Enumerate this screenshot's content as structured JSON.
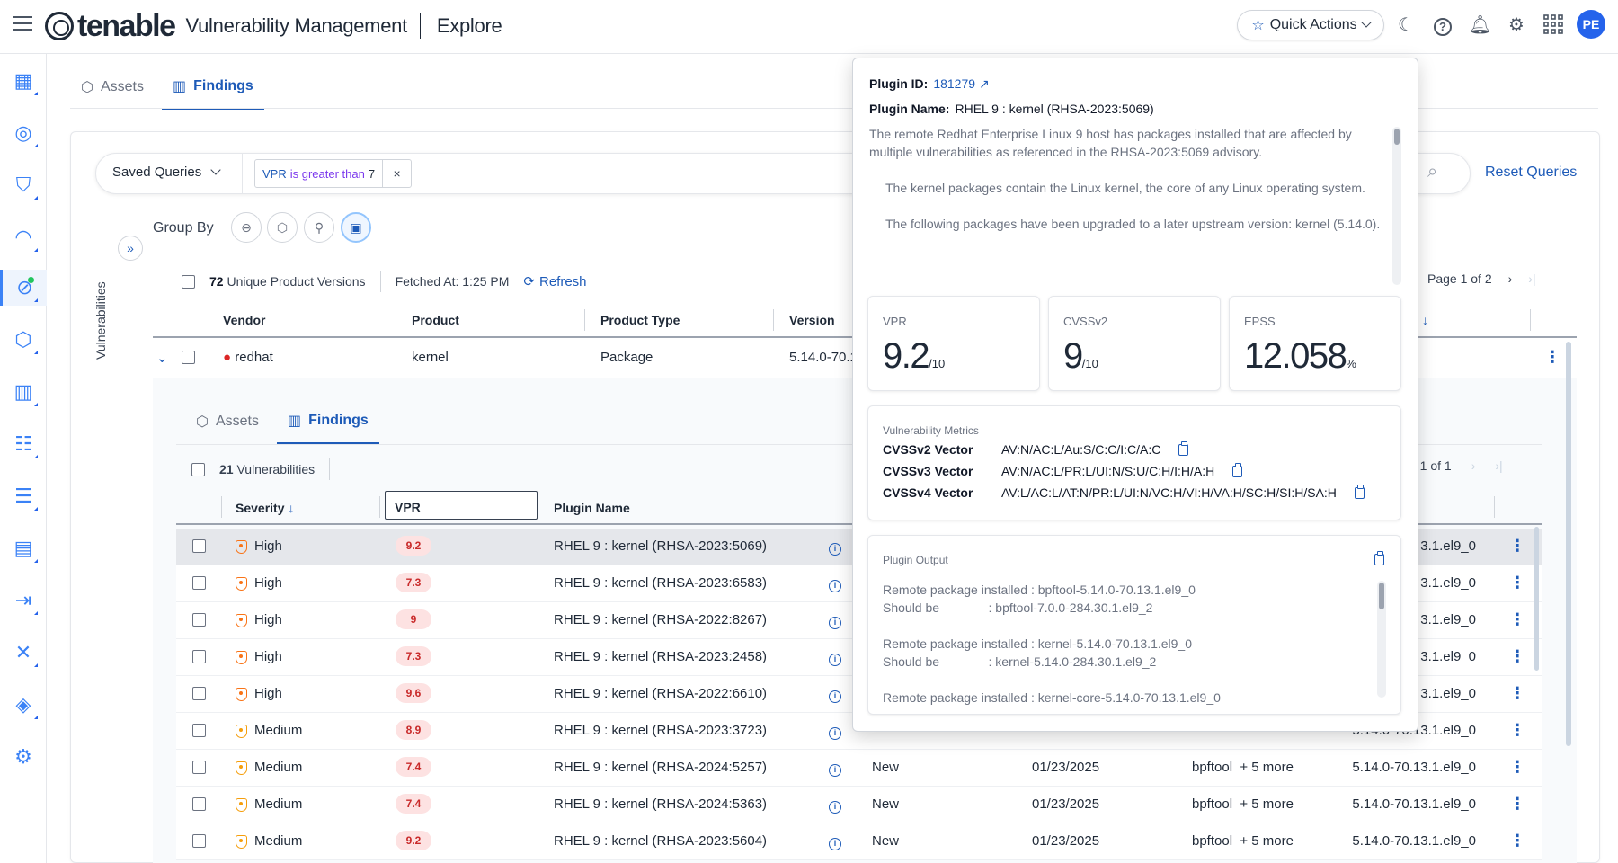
{
  "header": {
    "brand": "tenable",
    "product": "Vulnerability Management",
    "section": "Explore",
    "quick_actions": "Quick Actions",
    "avatar_initials": "PE"
  },
  "main_tabs": [
    {
      "label": "Assets"
    },
    {
      "label": "Findings"
    }
  ],
  "query": {
    "saved_queries": "Saved Queries",
    "chip_field": "VPR",
    "chip_operator": "is greater than",
    "chip_value": "7",
    "chip_remove": "×",
    "reset": "Reset Queries"
  },
  "group_by": "Group By",
  "side_label": "Vulnerabilities",
  "outer": {
    "count": "72",
    "count_label": "Unique Product Versions",
    "fetched": "Fetched At: 1:25 PM",
    "refresh": "Refresh",
    "page": "Page 1 of 2",
    "columns": [
      "Vendor",
      "Product",
      "Product Type",
      "Version"
    ],
    "row": {
      "vendor": "redhat",
      "product": "kernel",
      "type": "Package",
      "version": "5.14.0-70.1"
    }
  },
  "inner": {
    "tabs": [
      {
        "label": "Assets"
      },
      {
        "label": "Findings"
      }
    ],
    "count": "21",
    "count_label": "Vulnerabilities",
    "page": "e 1 of 1",
    "columns": [
      "Severity",
      "VPR",
      "Plugin Name"
    ],
    "rows": [
      {
        "severity": "High",
        "vpr": "9.2",
        "plugin": "RHEL 9 : kernel (RHSA-2023:5069)",
        "state": "",
        "date": "",
        "pkg": "",
        "ver": "3.1.el9_0"
      },
      {
        "severity": "High",
        "vpr": "7.3",
        "plugin": "RHEL 9 : kernel (RHSA-2023:6583)",
        "state": "",
        "date": "",
        "pkg": "",
        "ver": "3.1.el9_0"
      },
      {
        "severity": "High",
        "vpr": "9",
        "plugin": "RHEL 9 : kernel (RHSA-2022:8267)",
        "state": "",
        "date": "",
        "pkg": "",
        "ver": "3.1.el9_0"
      },
      {
        "severity": "High",
        "vpr": "7.3",
        "plugin": "RHEL 9 : kernel (RHSA-2023:2458)",
        "state": "",
        "date": "",
        "pkg": "",
        "ver": "3.1.el9_0"
      },
      {
        "severity": "High",
        "vpr": "9.6",
        "plugin": "RHEL 9 : kernel (RHSA-2022:6610)",
        "state": "",
        "date": "",
        "pkg": "",
        "ver": "3.1.el9_0"
      },
      {
        "severity": "Medium",
        "vpr": "8.9",
        "plugin": "RHEL 9 : kernel (RHSA-2023:3723)",
        "state": "",
        "date": "",
        "pkg": "",
        "ver": "5.14.0-70.13.1.el9_0"
      },
      {
        "severity": "Medium",
        "vpr": "7.4",
        "plugin": "RHEL 9 : kernel (RHSA-2024:5257)",
        "state": "New",
        "date": "01/23/2025",
        "pkg": "bpftool  + 5 more",
        "ver": "5.14.0-70.13.1.el9_0"
      },
      {
        "severity": "Medium",
        "vpr": "7.4",
        "plugin": "RHEL 9 : kernel (RHSA-2024:5363)",
        "state": "New",
        "date": "01/23/2025",
        "pkg": "bpftool  + 5 more",
        "ver": "5.14.0-70.13.1.el9_0"
      },
      {
        "severity": "Medium",
        "vpr": "9.2",
        "plugin": "RHEL 9 : kernel (RHSA-2023:5604)",
        "state": "New",
        "date": "01/23/2025",
        "pkg": "bpftool  + 5 more",
        "ver": "5.14.0-70.13.1.el9_0"
      }
    ]
  },
  "popover": {
    "plugin_id_label": "Plugin ID:",
    "plugin_id": "181279",
    "plugin_name_label": "Plugin Name:",
    "plugin_name": "RHEL 9 : kernel (RHSA-2023:5069)",
    "desc_1": "The remote Redhat Enterprise Linux 9 host has packages installed that are affected by multiple vulnerabilities as referenced in the RHSA-2023:5069 advisory.",
    "desc_2": "The kernel packages contain the Linux kernel, the core of any Linux operating system.",
    "desc_3": "The following packages have been upgraded to a later upstream version: kernel (5.14.0).",
    "vpr_label": "VPR",
    "vpr_value": "9.2",
    "vpr_unit": "/10",
    "cvss2_label": "CVSSv2",
    "cvss2_value": "9",
    "cvss2_unit": "/10",
    "epss_label": "EPSS",
    "epss_value": "12.058",
    "epss_unit": "%",
    "metrics_title": "Vulnerability Metrics",
    "v2_label": "CVSSv2 Vector",
    "v2": "AV:N/AC:L/Au:S/C:C/I:C/A:C",
    "v3_label": "CVSSv3 Vector",
    "v3": "AV:N/AC:L/PR:L/UI:N/S:U/C:H/I:H/A:H",
    "v4_label": "CVSSv4 Vector",
    "v4": "AV:L/AC:L/AT:N/PR:L/UI:N/VC:H/VI:H/VA:H/SC:H/SI:H/SA:H",
    "output_title": "Plugin Output",
    "output_text": "Remote package installed : bpftool-5.14.0-70.13.1.el9_0\nShould be              : bpftool-7.0.0-284.30.1.el9_2\n\nRemote package installed : kernel-5.14.0-70.13.1.el9_0\nShould be              : kernel-5.14.0-284.30.1.el9_2\n\nRemote package installed : kernel-core-5.14.0-70.13.1.el9_0"
  },
  "colors": {
    "accent": "#1e5bb8",
    "high": "#f97316",
    "medium": "#f59e0b",
    "vpr_pill_bg": "#fde2e2"
  }
}
